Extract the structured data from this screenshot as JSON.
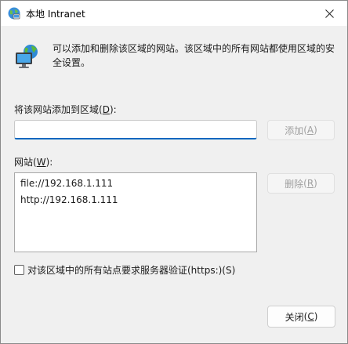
{
  "window": {
    "title": "本地 Intranet",
    "close_glyph": "✕"
  },
  "description": "可以添加和删除该区域的网站。该区域中的所有网站都使用区域的安全设置。",
  "add_section": {
    "label": "将该网站添加到区域",
    "label_key": "D",
    "input_value": "",
    "add_button": {
      "label": "添加",
      "key": "A"
    }
  },
  "sites_section": {
    "label": "网站",
    "label_key": "W",
    "items": [
      "file://192.168.1.111",
      "http://192.168.1.111"
    ],
    "remove_button": {
      "label": "删除",
      "key": "R"
    }
  },
  "https_check": {
    "label": "对该区域中的所有站点要求服务器验证(https:)(S)",
    "checked": false
  },
  "close_button": {
    "label": "关闭",
    "key": "C"
  },
  "colors": {
    "accent": "#0067c0",
    "background": "#f0f0f0",
    "disabled_text": "#a0a0a0"
  },
  "icons": {
    "title": "intranet-globe-icon",
    "header": "network-computer-globe-icon"
  }
}
